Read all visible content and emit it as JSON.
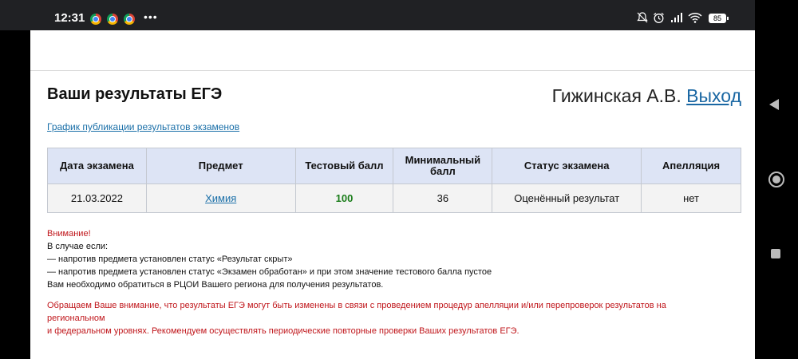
{
  "statusbar": {
    "time": "12:31",
    "more": "•••",
    "battery": "85",
    "icons": [
      "chrome-icon",
      "mute-icon",
      "alarm-icon",
      "signal-icon",
      "wifi-icon",
      "battery-icon"
    ]
  },
  "header": {
    "title": "Ваши результаты ЕГЭ",
    "user_name": "Гижинская А.В.",
    "logout": "Выход"
  },
  "schedule_link": "График публикации результатов экзаменов",
  "table": {
    "headers": [
      "Дата экзамена",
      "Предмет",
      "Тестовый балл",
      "Минимальный балл",
      "Статус экзамена",
      "Апелляция"
    ],
    "rows": [
      {
        "date": "21.03.2022",
        "subject": "Химия",
        "score": "100",
        "min_score": "36",
        "status": "Оценённый результат",
        "appeal": "нет"
      }
    ]
  },
  "notes": {
    "attention": "Внимание!",
    "line1": "В случае если:",
    "line2": "— напротив предмета установлен статус «Результат скрыт»",
    "line3": "— напротив предмета установлен статус «Экзамен обработан» и при этом значение тестового балла пустое",
    "line4": "Вам необходимо обратиться в РЦОИ Вашего региона для получения результатов."
  },
  "notice": {
    "line1": "Обращаем Ваше внимание, что результаты ЕГЭ могут быть изменены в связи с проведением процедур апелляции и/или перепроверок результатов на региональном",
    "line2": "и федеральном уровнях. Рекомендуем осуществлять периодические повторные проверки Ваших результатов ЕГЭ."
  }
}
